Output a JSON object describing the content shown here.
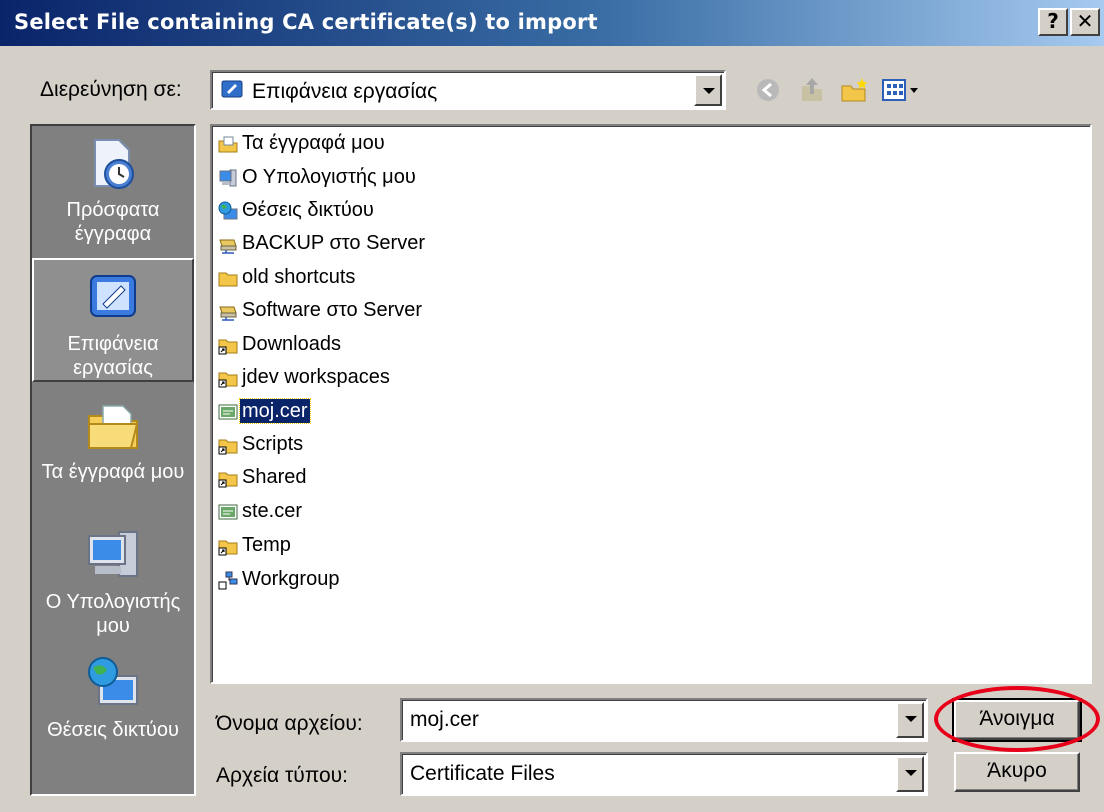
{
  "window": {
    "title": "Select File containing CA certificate(s) to import",
    "help_label": "?",
    "close_label": "✕"
  },
  "lookin": {
    "label": "Διερεύνηση σε:",
    "value": "Επιφάνεια εργασίας"
  },
  "toolbar": {
    "icons": [
      "back-icon",
      "up-folder-icon",
      "new-folder-icon",
      "view-menu-icon"
    ]
  },
  "places": [
    {
      "label": "Πρόσφατα έγγραφα",
      "icon": "recent-documents-icon"
    },
    {
      "label": "Επιφάνεια εργασίας",
      "icon": "desktop-icon",
      "selected": true
    },
    {
      "label": "Τα έγγραφά μου",
      "icon": "my-documents-icon"
    },
    {
      "label": "Ο Υπολογιστής μου",
      "icon": "my-computer-icon"
    },
    {
      "label": "Θέσεις δικτύου",
      "icon": "network-places-icon"
    }
  ],
  "files": [
    {
      "name": "Τα έγγραφά μου",
      "icon": "my-documents-icon"
    },
    {
      "name": "Ο Υπολογιστής μου",
      "icon": "my-computer-icon"
    },
    {
      "name": "Θέσεις δικτύου",
      "icon": "network-places-icon"
    },
    {
      "name": "BACKUP στο Server",
      "icon": "network-drive-icon"
    },
    {
      "name": "old shortcuts",
      "icon": "folder-icon"
    },
    {
      "name": "Software στο Server",
      "icon": "network-drive-icon"
    },
    {
      "name": "Downloads",
      "icon": "folder-shortcut-icon"
    },
    {
      "name": "jdev workspaces",
      "icon": "folder-shortcut-icon"
    },
    {
      "name": "moj.cer",
      "icon": "certificate-icon",
      "selected": true
    },
    {
      "name": "Scripts",
      "icon": "folder-shortcut-icon"
    },
    {
      "name": "Shared",
      "icon": "folder-shortcut-icon"
    },
    {
      "name": "ste.cer",
      "icon": "certificate-icon"
    },
    {
      "name": "Temp",
      "icon": "folder-shortcut-icon"
    },
    {
      "name": "Workgroup",
      "icon": "workgroup-icon"
    }
  ],
  "filename": {
    "label": "Όνομα αρχείου:",
    "value": "moj.cer"
  },
  "filetype": {
    "label": "Αρχεία τύπου:",
    "value": "Certificate Files"
  },
  "buttons": {
    "open": "Άνοιγμα",
    "cancel": "Άκυρο"
  },
  "colors": {
    "title_start": "#0a246a",
    "selection": "#0a246a",
    "highlight_ellipse": "#e8001a"
  }
}
